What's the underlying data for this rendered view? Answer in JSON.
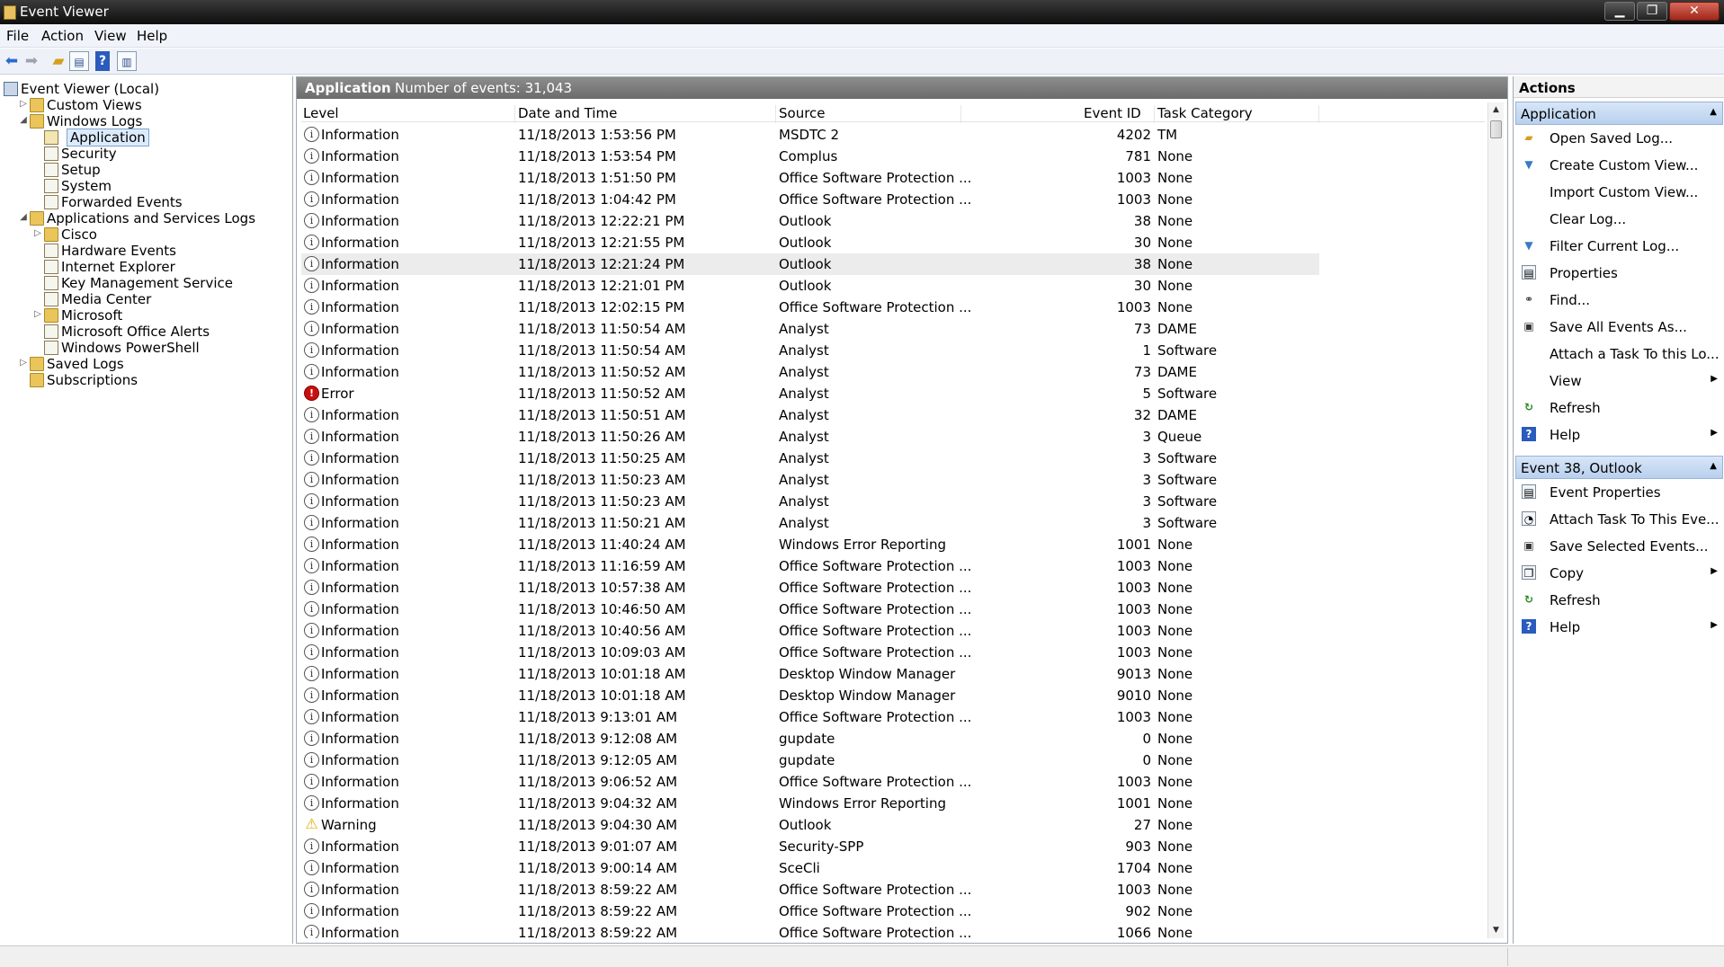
{
  "window": {
    "title": "Event Viewer"
  },
  "menu": [
    "File",
    "Action",
    "View",
    "Help"
  ],
  "toolbar": {
    "icons": [
      "back-arrow-icon",
      "forward-arrow-icon",
      "up-folder-icon",
      "show-hide-tree-icon",
      "help-icon",
      "show-hide-action-pane-icon"
    ]
  },
  "tree": [
    {
      "label": "Event Viewer (Local)",
      "level": 0,
      "icon": "computer-icon",
      "expander": ""
    },
    {
      "label": "Custom Views",
      "level": 1,
      "icon": "folder-icon",
      "expander": "collapsed"
    },
    {
      "label": "Windows Logs",
      "level": 1,
      "icon": "folder-icon",
      "expander": "expanded"
    },
    {
      "label": "Application",
      "level": 2,
      "icon": "log-icon",
      "expander": "",
      "selected": true
    },
    {
      "label": "Security",
      "level": 2,
      "icon": "log-icon",
      "expander": ""
    },
    {
      "label": "Setup",
      "level": 2,
      "icon": "log-icon",
      "expander": ""
    },
    {
      "label": "System",
      "level": 2,
      "icon": "log-icon",
      "expander": ""
    },
    {
      "label": "Forwarded Events",
      "level": 2,
      "icon": "log-icon",
      "expander": ""
    },
    {
      "label": "Applications and Services Logs",
      "level": 1,
      "icon": "folder-icon",
      "expander": "expanded"
    },
    {
      "label": "Cisco",
      "level": 2,
      "icon": "folder-icon",
      "expander": "collapsed"
    },
    {
      "label": "Hardware Events",
      "level": 2,
      "icon": "log-icon",
      "expander": ""
    },
    {
      "label": "Internet Explorer",
      "level": 2,
      "icon": "log-icon",
      "expander": ""
    },
    {
      "label": "Key Management Service",
      "level": 2,
      "icon": "log-icon",
      "expander": ""
    },
    {
      "label": "Media Center",
      "level": 2,
      "icon": "log-icon",
      "expander": ""
    },
    {
      "label": "Microsoft",
      "level": 2,
      "icon": "folder-icon",
      "expander": "collapsed"
    },
    {
      "label": "Microsoft Office Alerts",
      "level": 2,
      "icon": "log-icon",
      "expander": ""
    },
    {
      "label": "Windows PowerShell",
      "level": 2,
      "icon": "log-icon",
      "expander": ""
    },
    {
      "label": "Saved Logs",
      "level": 1,
      "icon": "folder-icon",
      "expander": "collapsed"
    },
    {
      "label": "Subscriptions",
      "level": 1,
      "icon": "folder-icon",
      "expander": ""
    }
  ],
  "center": {
    "log_name": "Application",
    "event_count": "Number of events: 31,043",
    "columns": [
      "Level",
      "Date and Time",
      "Source",
      "Event ID",
      "Task Category"
    ],
    "rows": [
      {
        "level": "Information",
        "type": "info",
        "date": "11/18/2013 1:53:56 PM",
        "source": "MSDTC 2",
        "id": "4202",
        "task": "TM"
      },
      {
        "level": "Information",
        "type": "info",
        "date": "11/18/2013 1:53:54 PM",
        "source": "Complus",
        "id": "781",
        "task": "None"
      },
      {
        "level": "Information",
        "type": "info",
        "date": "11/18/2013 1:51:50 PM",
        "source": "Office Software Protection ...",
        "id": "1003",
        "task": "None"
      },
      {
        "level": "Information",
        "type": "info",
        "date": "11/18/2013 1:04:42 PM",
        "source": "Office Software Protection ...",
        "id": "1003",
        "task": "None"
      },
      {
        "level": "Information",
        "type": "info",
        "date": "11/18/2013 12:22:21 PM",
        "source": "Outlook",
        "id": "38",
        "task": "None"
      },
      {
        "level": "Information",
        "type": "info",
        "date": "11/18/2013 12:21:55 PM",
        "source": "Outlook",
        "id": "30",
        "task": "None"
      },
      {
        "level": "Information",
        "type": "info",
        "date": "11/18/2013 12:21:24 PM",
        "source": "Outlook",
        "id": "38",
        "task": "None",
        "highlighted": true
      },
      {
        "level": "Information",
        "type": "info",
        "date": "11/18/2013 12:21:01 PM",
        "source": "Outlook",
        "id": "30",
        "task": "None"
      },
      {
        "level": "Information",
        "type": "info",
        "date": "11/18/2013 12:02:15 PM",
        "source": "Office Software Protection ...",
        "id": "1003",
        "task": "None"
      },
      {
        "level": "Information",
        "type": "info",
        "date": "11/18/2013 11:50:54 AM",
        "source": "Analyst",
        "id": "73",
        "task": "DAME"
      },
      {
        "level": "Information",
        "type": "info",
        "date": "11/18/2013 11:50:54 AM",
        "source": "Analyst",
        "id": "1",
        "task": "Software"
      },
      {
        "level": "Information",
        "type": "info",
        "date": "11/18/2013 11:50:52 AM",
        "source": "Analyst",
        "id": "73",
        "task": "DAME"
      },
      {
        "level": "Error",
        "type": "error",
        "date": "11/18/2013 11:50:52 AM",
        "source": "Analyst",
        "id": "5",
        "task": "Software"
      },
      {
        "level": "Information",
        "type": "info",
        "date": "11/18/2013 11:50:51 AM",
        "source": "Analyst",
        "id": "32",
        "task": "DAME"
      },
      {
        "level": "Information",
        "type": "info",
        "date": "11/18/2013 11:50:26 AM",
        "source": "Analyst",
        "id": "3",
        "task": "Queue"
      },
      {
        "level": "Information",
        "type": "info",
        "date": "11/18/2013 11:50:25 AM",
        "source": "Analyst",
        "id": "3",
        "task": "Software"
      },
      {
        "level": "Information",
        "type": "info",
        "date": "11/18/2013 11:50:23 AM",
        "source": "Analyst",
        "id": "3",
        "task": "Software"
      },
      {
        "level": "Information",
        "type": "info",
        "date": "11/18/2013 11:50:23 AM",
        "source": "Analyst",
        "id": "3",
        "task": "Software"
      },
      {
        "level": "Information",
        "type": "info",
        "date": "11/18/2013 11:50:21 AM",
        "source": "Analyst",
        "id": "3",
        "task": "Software"
      },
      {
        "level": "Information",
        "type": "info",
        "date": "11/18/2013 11:40:24 AM",
        "source": "Windows Error Reporting",
        "id": "1001",
        "task": "None"
      },
      {
        "level": "Information",
        "type": "info",
        "date": "11/18/2013 11:16:59 AM",
        "source": "Office Software Protection ...",
        "id": "1003",
        "task": "None"
      },
      {
        "level": "Information",
        "type": "info",
        "date": "11/18/2013 10:57:38 AM",
        "source": "Office Software Protection ...",
        "id": "1003",
        "task": "None"
      },
      {
        "level": "Information",
        "type": "info",
        "date": "11/18/2013 10:46:50 AM",
        "source": "Office Software Protection ...",
        "id": "1003",
        "task": "None"
      },
      {
        "level": "Information",
        "type": "info",
        "date": "11/18/2013 10:40:56 AM",
        "source": "Office Software Protection ...",
        "id": "1003",
        "task": "None"
      },
      {
        "level": "Information",
        "type": "info",
        "date": "11/18/2013 10:09:03 AM",
        "source": "Office Software Protection ...",
        "id": "1003",
        "task": "None"
      },
      {
        "level": "Information",
        "type": "info",
        "date": "11/18/2013 10:01:18 AM",
        "source": "Desktop Window Manager",
        "id": "9013",
        "task": "None"
      },
      {
        "level": "Information",
        "type": "info",
        "date": "11/18/2013 10:01:18 AM",
        "source": "Desktop Window Manager",
        "id": "9010",
        "task": "None"
      },
      {
        "level": "Information",
        "type": "info",
        "date": "11/18/2013 9:13:01 AM",
        "source": "Office Software Protection ...",
        "id": "1003",
        "task": "None"
      },
      {
        "level": "Information",
        "type": "info",
        "date": "11/18/2013 9:12:08 AM",
        "source": "gupdate",
        "id": "0",
        "task": "None"
      },
      {
        "level": "Information",
        "type": "info",
        "date": "11/18/2013 9:12:05 AM",
        "source": "gupdate",
        "id": "0",
        "task": "None"
      },
      {
        "level": "Information",
        "type": "info",
        "date": "11/18/2013 9:06:52 AM",
        "source": "Office Software Protection ...",
        "id": "1003",
        "task": "None"
      },
      {
        "level": "Information",
        "type": "info",
        "date": "11/18/2013 9:04:32 AM",
        "source": "Windows Error Reporting",
        "id": "1001",
        "task": "None"
      },
      {
        "level": "Warning",
        "type": "warning",
        "date": "11/18/2013 9:04:30 AM",
        "source": "Outlook",
        "id": "27",
        "task": "None"
      },
      {
        "level": "Information",
        "type": "info",
        "date": "11/18/2013 9:01:07 AM",
        "source": "Security-SPP",
        "id": "903",
        "task": "None"
      },
      {
        "level": "Information",
        "type": "info",
        "date": "11/18/2013 9:00:14 AM",
        "source": "SceCli",
        "id": "1704",
        "task": "None"
      },
      {
        "level": "Information",
        "type": "info",
        "date": "11/18/2013 8:59:22 AM",
        "source": "Office Software Protection ...",
        "id": "1003",
        "task": "None"
      },
      {
        "level": "Information",
        "type": "info",
        "date": "11/18/2013 8:59:22 AM",
        "source": "Office Software Protection ...",
        "id": "902",
        "task": "None"
      },
      {
        "level": "Information",
        "type": "info",
        "date": "11/18/2013 8:59:22 AM",
        "source": "Office Software Protection ...",
        "id": "1066",
        "task": "None"
      }
    ]
  },
  "actions": {
    "title": "Actions",
    "sections": [
      {
        "title": "Application",
        "items": [
          {
            "label": "Open Saved Log...",
            "icon": "open-folder-icon",
            "submenu": false
          },
          {
            "label": "Create Custom View...",
            "icon": "filter-icon",
            "submenu": false
          },
          {
            "label": "Import Custom View...",
            "icon": "",
            "submenu": false
          },
          {
            "label": "Clear Log...",
            "icon": "",
            "submenu": false
          },
          {
            "label": "Filter Current Log...",
            "icon": "filter-icon",
            "submenu": false
          },
          {
            "label": "Properties",
            "icon": "properties-icon",
            "submenu": false
          },
          {
            "label": "Find...",
            "icon": "binoculars-icon",
            "submenu": false
          },
          {
            "label": "Save All Events As...",
            "icon": "save-icon",
            "submenu": false
          },
          {
            "label": "Attach a Task To this Lo...",
            "icon": "",
            "submenu": false
          },
          {
            "label": "View",
            "icon": "",
            "submenu": true
          },
          {
            "label": "Refresh",
            "icon": "refresh-icon",
            "submenu": false
          },
          {
            "label": "Help",
            "icon": "help-icon",
            "submenu": true
          }
        ]
      },
      {
        "title": "Event 38, Outlook",
        "items": [
          {
            "label": "Event Properties",
            "icon": "properties-icon",
            "submenu": false
          },
          {
            "label": "Attach Task To This Eve...",
            "icon": "task-icon",
            "submenu": false
          },
          {
            "label": "Save Selected Events...",
            "icon": "save-icon",
            "submenu": false
          },
          {
            "label": "Copy",
            "icon": "copy-icon",
            "submenu": true
          },
          {
            "label": "Refresh",
            "icon": "refresh-icon",
            "submenu": false
          },
          {
            "label": "Help",
            "icon": "help-icon",
            "submenu": true
          }
        ]
      }
    ]
  },
  "colors": {
    "titlebar": "#1a1a1a",
    "center_header": "#7a7a7a",
    "section_header": "#c8dbf2",
    "selection": "#dcebfc",
    "error": "#c81010",
    "warning": "#e2b000"
  }
}
